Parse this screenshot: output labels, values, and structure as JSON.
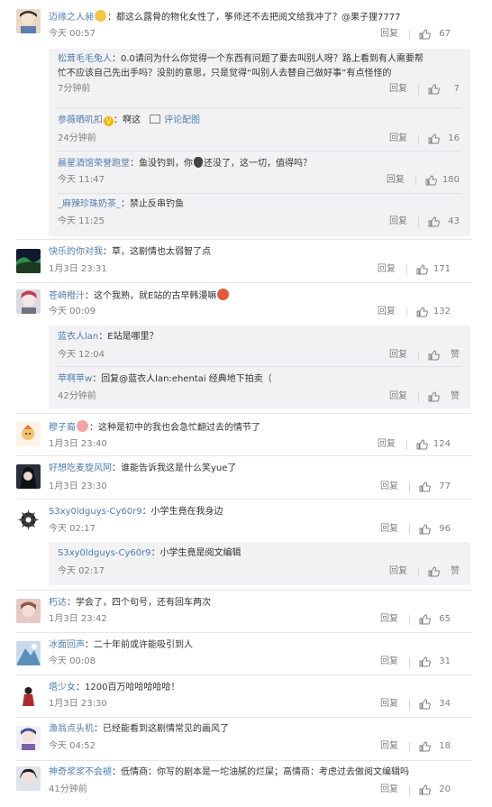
{
  "reply_label": "回复",
  "comments": [
    {
      "user": "迈缘之人昶",
      "text": "：都这么露骨的物化女性了，筝师还不去把阅文给我冲了？@果子狸7777",
      "emoji": "yellow",
      "time": "今天 00:57",
      "likes": "67"
    },
    {
      "user": "快乐的你对我",
      "text": "：草，这剧情也太弱智了点",
      "time": "1月3日 23:31",
      "likes": "171"
    },
    {
      "user": "苍崎橙汁",
      "text": "：这个我熟，就E站的古早韩漫嘛",
      "emoji": "red",
      "time": "今天 00:09",
      "likes": "132"
    },
    {
      "user": "穆子裔",
      "text": "：这种是初中的我也会急忙翻过去的情节了",
      "emoji": "pink",
      "time": "1月3日 23:40",
      "likes": "124"
    },
    {
      "user": "好想吃麦旋风阿",
      "text": "：谁能告诉我这是什么笑yue了",
      "time": "1月3日 23:30",
      "likes": "77"
    },
    {
      "user": "S3xy0ldguys-Cy60r9",
      "text": "：小学生竟在我身边",
      "time": "今天 02:17",
      "likes": "96"
    },
    {
      "user": "朽达",
      "text": "：学会了，四个句号，还有回车两次",
      "time": "1月3日 23:42",
      "likes": "65"
    },
    {
      "user": "冰面回声",
      "text": "：二十年前或许能吸引到人",
      "time": "今天 00:08",
      "likes": "31"
    },
    {
      "user": "塔少女",
      "text": "：1200百万哈哈哈哈哈！",
      "time": "1月3日 23:30",
      "likes": "34"
    },
    {
      "user": "渔翁点头机",
      "text": "：已经能看到这剧情常见的画风了",
      "time": "今天 04:52",
      "likes": "18"
    },
    {
      "user": "神奇浆浆不会褪",
      "text": "：低情商：你写的剧本是一坨油腻的烂屎；高情商：考虑过去做阅文编辑吗",
      "time": "41分钟前",
      "likes": "20"
    }
  ],
  "replies_1": [
    {
      "user": "松茸毛毛兔人",
      "text": "：0.0请问为什么你觉得一个东西有问题了要去叫别人呀？路上看到有人需要帮",
      "text2": "忙不应该自己先出手吗？没别的意思，只是觉得“叫别人去替自己做好事”有点怪怪的",
      "time": "7分钟前",
      "likes": "7"
    },
    {
      "user": "参薇晒叽扣",
      "text": "：啊这",
      "pic_label": "评论配图",
      "time": "24分钟前",
      "likes": "16"
    },
    {
      "user": "晨星酒馆荣誉跑堂",
      "text_a": "：鱼没钓到，你",
      "text_b": "还没了，这一切，值得吗？",
      "time": "今天 11:47",
      "likes": "180"
    },
    {
      "user": "_麻辣珍珠奶茶_",
      "text": "：禁止反串钓鱼",
      "time": "今天 11:25",
      "likes": "43"
    }
  ],
  "replies_3": [
    {
      "user": "蓝衣人lan",
      "text": "：E站是哪里？",
      "time": "今天 12:04",
      "likes": "赞"
    },
    {
      "user": "苹啊苹w",
      "text": "：回复@蓝衣人lan:ehentai 经典地下拍卖（",
      "time": "42分钟前",
      "likes": "赞"
    }
  ],
  "replies_6": [
    {
      "user": "S3xy0ldguys-Cy60r9",
      "text": "：小学生竟是阅文编辑",
      "time": "今天 02:17",
      "likes": "赞"
    }
  ]
}
